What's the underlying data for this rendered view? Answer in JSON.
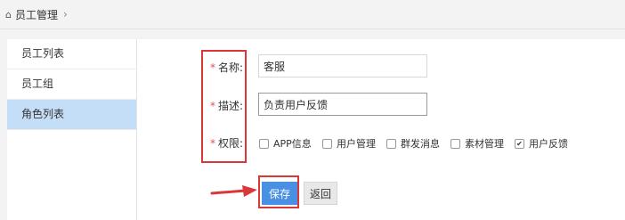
{
  "breadcrumb": {
    "home_icon": "home-icon",
    "current": "员工管理",
    "separator": "›"
  },
  "sidebar": {
    "items": [
      {
        "label": "员工列表",
        "active": false
      },
      {
        "label": "员工组",
        "active": false
      },
      {
        "label": "角色列表",
        "active": true
      }
    ]
  },
  "form": {
    "required_mark": "*",
    "name": {
      "label": "名称:",
      "value": "客服"
    },
    "description": {
      "label": "描述:",
      "value": "负责用户反馈"
    },
    "permissions": {
      "label": "权限:",
      "options": [
        {
          "label": "APP信息",
          "checked": false
        },
        {
          "label": "用户管理",
          "checked": false
        },
        {
          "label": "群发消息",
          "checked": false
        },
        {
          "label": "素材管理",
          "checked": false
        },
        {
          "label": "用户反馈",
          "checked": true
        }
      ]
    }
  },
  "actions": {
    "save_label": "保存",
    "back_label": "返回"
  },
  "colors": {
    "primary": "#4a90e2",
    "highlight": "#d93838",
    "active_nav": "#c5def7"
  }
}
